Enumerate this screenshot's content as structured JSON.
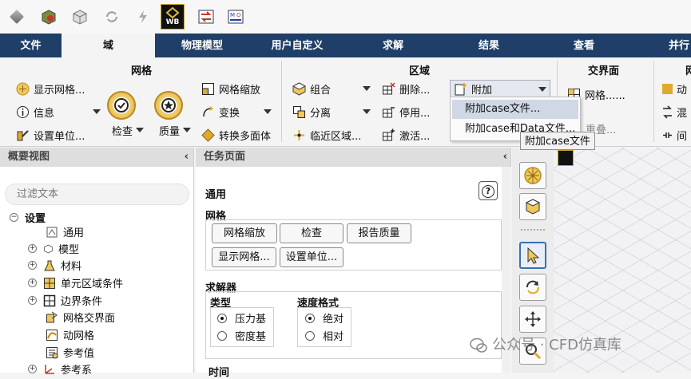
{
  "toolbar_icons": [
    "cube-icon",
    "mesh-cube-icon",
    "cube-outline-icon",
    "refresh-icon",
    "lightning-icon",
    "wb-icon",
    "swap-icon",
    "mo-icon"
  ],
  "wb_label": "WB",
  "tabs": [
    "文件",
    "域",
    "物理模型",
    "用户自定义",
    "求解",
    "结果",
    "查看",
    "并行"
  ],
  "active_tab": "域",
  "ribbon": {
    "mesh_group": {
      "title": "网格",
      "display_mesh": "显示网格...",
      "info": "信息",
      "set_units": "设置单位...",
      "check": "检查",
      "quality": "质量",
      "scale": "网格缩放",
      "transform": "变换",
      "convert_polyhedra": "转换多面体"
    },
    "zones_group": {
      "title": "区域",
      "combine": "组合",
      "separate": "分离",
      "adjacency": "临近区域...",
      "delete": "删除...",
      "deactivate": "停用...",
      "activate": "激活...",
      "append": "附加"
    },
    "interfaces_group": {
      "title": "交界面",
      "mesh": "网格......",
      "overlap": "重叠..."
    },
    "partial_group": {
      "title": "网",
      "items": [
        "动",
        "混",
        "间"
      ]
    }
  },
  "append_menu": {
    "items": [
      "附加case文件...",
      "附加case和Data文件..."
    ],
    "tooltip": "附加case文件"
  },
  "outline": {
    "header": "概要视图",
    "filter_placeholder": "过滤文本",
    "tree": [
      {
        "label": "设置",
        "toggle": "−"
      },
      {
        "label": "通用"
      },
      {
        "label": "模型",
        "toggle": "+"
      },
      {
        "label": "材料",
        "toggle": "+"
      },
      {
        "label": "单元区域条件",
        "toggle": "+"
      },
      {
        "label": "边界条件",
        "toggle": "+"
      },
      {
        "label": "网格交界面"
      },
      {
        "label": "动网格"
      },
      {
        "label": "参考值"
      },
      {
        "label": "参考系",
        "toggle": "+"
      }
    ]
  },
  "task": {
    "header": "任务页面",
    "section": "通用",
    "mesh_label": "网格",
    "buttons": [
      "网格缩放",
      "检查",
      "报告质量",
      "显示网格...",
      "设置单位..."
    ],
    "solver_label": "求解器",
    "type_label": "类型",
    "type_options": [
      {
        "label": "压力基",
        "selected": true
      },
      {
        "label": "密度基",
        "selected": false
      }
    ],
    "velocity_label": "速度格式",
    "velocity_options": [
      {
        "label": "绝对",
        "selected": true
      },
      {
        "label": "相对",
        "selected": false
      }
    ],
    "time_label": "时间"
  },
  "watermark": "公众号 · CFD仿真库",
  "colors": {
    "tab_bar": "#1f3f68",
    "menu_highlight": "#cfd8e4",
    "gold": "#e0a92a"
  }
}
